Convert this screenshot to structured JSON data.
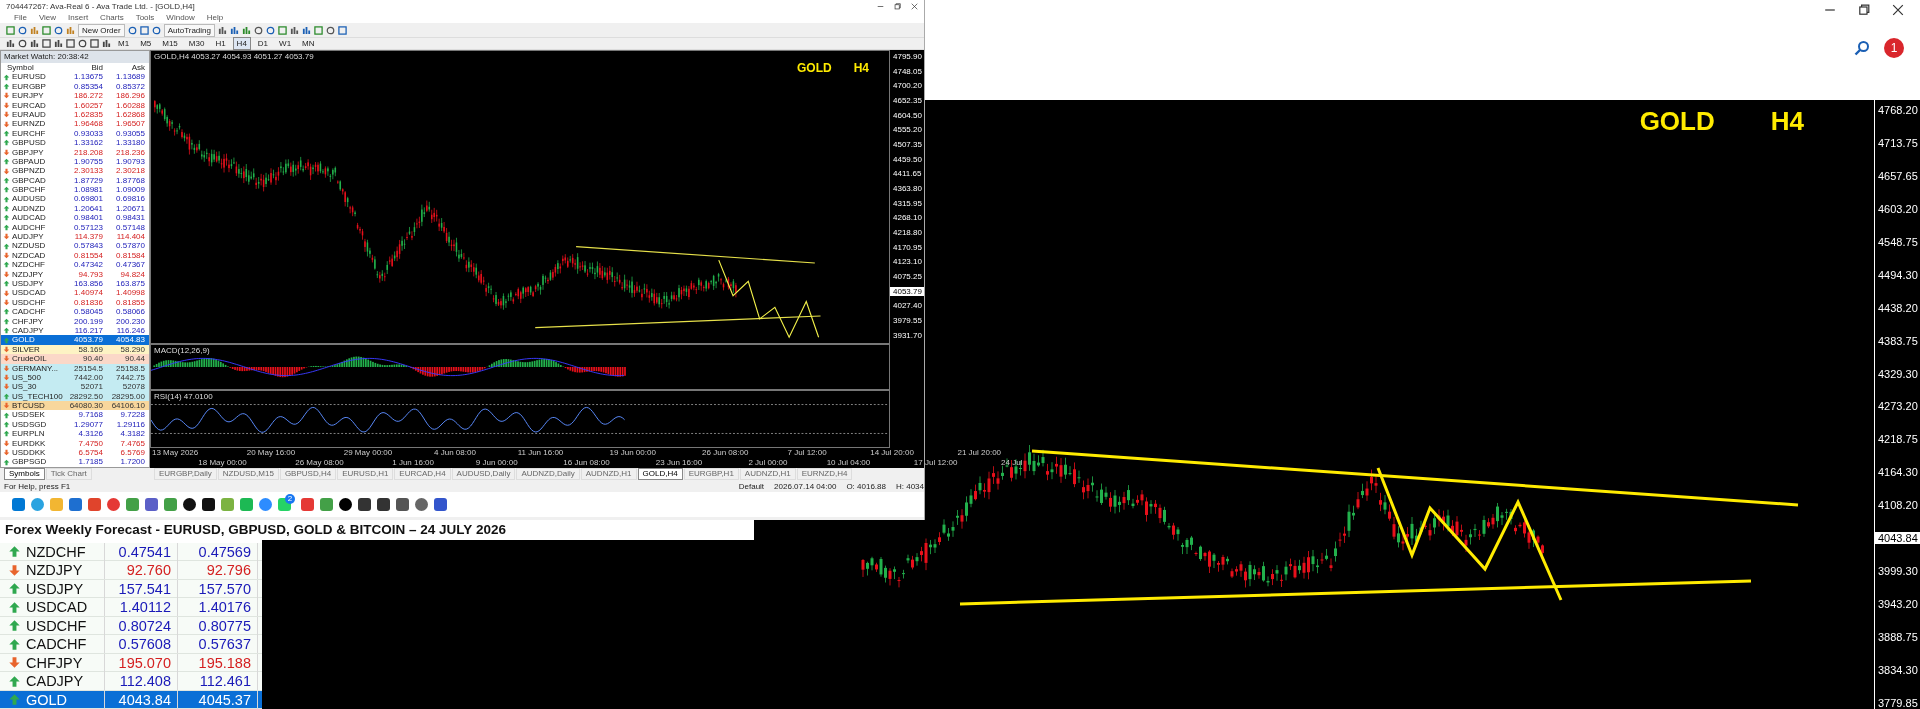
{
  "window": {
    "title": "704447267: Ava-Real 6 - Ava Trade Ltd. - [GOLD,H4]"
  },
  "menu": [
    "File",
    "View",
    "Insert",
    "Charts",
    "Tools",
    "Window",
    "Help"
  ],
  "toolbar": {
    "new_order": "New Order",
    "auto_trading": "AutoTrading"
  },
  "timeframes": [
    {
      "label": "M1",
      "selected": false
    },
    {
      "label": "M5",
      "selected": false
    },
    {
      "label": "M15",
      "selected": false
    },
    {
      "label": "M30",
      "selected": false
    },
    {
      "label": "H1",
      "selected": false
    },
    {
      "label": "H4",
      "selected": true
    },
    {
      "label": "D1",
      "selected": false
    },
    {
      "label": "W1",
      "selected": false
    },
    {
      "label": "MN",
      "selected": false
    }
  ],
  "market_watch": {
    "title": "Market Watch: 20:38:42",
    "columns": [
      "Symbol",
      "Bid",
      "Ask"
    ],
    "rows": [
      {
        "symbol": "EURUSD",
        "bid": "1.13675",
        "ask": "1.13689",
        "rising": true,
        "selected": false
      },
      {
        "symbol": "EURGBP",
        "bid": "0.85354",
        "ask": "0.85372",
        "rising": true,
        "selected": false
      },
      {
        "symbol": "EURJPY",
        "bid": "186.272",
        "ask": "186.296",
        "rising": false,
        "selected": false
      },
      {
        "symbol": "EURCAD",
        "bid": "1.60257",
        "ask": "1.60288",
        "rising": false,
        "selected": false
      },
      {
        "symbol": "EURAUD",
        "bid": "1.62835",
        "ask": "1.62868",
        "rising": false,
        "selected": false
      },
      {
        "symbol": "EURNZD",
        "bid": "1.96468",
        "ask": "1.96507",
        "rising": false,
        "selected": false
      },
      {
        "symbol": "EURCHF",
        "bid": "0.93033",
        "ask": "0.93055",
        "rising": true,
        "selected": false
      },
      {
        "symbol": "GBPUSD",
        "bid": "1.33162",
        "ask": "1.33180",
        "rising": true,
        "selected": false
      },
      {
        "symbol": "GBPJPY",
        "bid": "218.208",
        "ask": "218.236",
        "rising": false,
        "selected": false
      },
      {
        "symbol": "GBPAUD",
        "bid": "1.90755",
        "ask": "1.90793",
        "rising": true,
        "selected": false
      },
      {
        "symbol": "GBPNZD",
        "bid": "2.30133",
        "ask": "2.30218",
        "rising": false,
        "selected": false
      },
      {
        "symbol": "GBPCAD",
        "bid": "1.87729",
        "ask": "1.87768",
        "rising": true,
        "selected": false
      },
      {
        "symbol": "GBPCHF",
        "bid": "1.08981",
        "ask": "1.09009",
        "rising": true,
        "selected": false
      },
      {
        "symbol": "AUDUSD",
        "bid": "0.69801",
        "ask": "0.69816",
        "rising": true,
        "selected": false
      },
      {
        "symbol": "AUDNZD",
        "bid": "1.20641",
        "ask": "1.20671",
        "rising": true,
        "selected": false
      },
      {
        "symbol": "AUDCAD",
        "bid": "0.98401",
        "ask": "0.98431",
        "rising": true,
        "selected": false
      },
      {
        "symbol": "AUDCHF",
        "bid": "0.57123",
        "ask": "0.57148",
        "rising": true,
        "selected": false
      },
      {
        "symbol": "AUDJPY",
        "bid": "114.379",
        "ask": "114.404",
        "rising": false,
        "selected": false
      },
      {
        "symbol": "NZDUSD",
        "bid": "0.57843",
        "ask": "0.57870",
        "rising": true,
        "selected": false
      },
      {
        "symbol": "NZDCAD",
        "bid": "0.81554",
        "ask": "0.81584",
        "rising": false,
        "selected": false
      },
      {
        "symbol": "NZDCHF",
        "bid": "0.47342",
        "ask": "0.47367",
        "rising": true,
        "selected": false
      },
      {
        "symbol": "NZDJPY",
        "bid": "94.793",
        "ask": "94.824",
        "rising": false,
        "selected": false
      },
      {
        "symbol": "USDJPY",
        "bid": "163.856",
        "ask": "163.875",
        "rising": true,
        "selected": false
      },
      {
        "symbol": "USDCAD",
        "bid": "1.40974",
        "ask": "1.40998",
        "rising": false,
        "selected": false
      },
      {
        "symbol": "USDCHF",
        "bid": "0.81836",
        "ask": "0.81855",
        "rising": false,
        "selected": false
      },
      {
        "symbol": "CADCHF",
        "bid": "0.58045",
        "ask": "0.58066",
        "rising": true,
        "selected": false
      },
      {
        "symbol": "CHFJPY",
        "bid": "200.199",
        "ask": "200.230",
        "rising": true,
        "selected": false
      },
      {
        "symbol": "CADJPY",
        "bid": "116.217",
        "ask": "116.246",
        "rising": true,
        "selected": false
      },
      {
        "symbol": "GOLD",
        "bid": "4053.79",
        "ask": "4054.83",
        "rising": true,
        "selected": true
      },
      {
        "symbol": "SILVER",
        "bid": "58.169",
        "ask": "58.290",
        "rising": false,
        "selected": false,
        "color": "#fdf3c4"
      },
      {
        "symbol": "CrudeOIL",
        "bid": "90.40",
        "ask": "90.44",
        "rising": false,
        "selected": false,
        "color": "#fbd8c8"
      },
      {
        "symbol": "GERMANY...",
        "bid": "25154.5",
        "ask": "25158.5",
        "rising": false,
        "selected": false,
        "color": "#c4ebf2"
      },
      {
        "symbol": "US_500",
        "bid": "7442.00",
        "ask": "7442.75",
        "rising": false,
        "selected": false,
        "color": "#c4ebf2"
      },
      {
        "symbol": "US_30",
        "bid": "52071",
        "ask": "52078",
        "rising": false,
        "selected": false,
        "color": "#c4ebf2"
      },
      {
        "symbol": "US_TECH100",
        "bid": "28292.50",
        "ask": "28295.00",
        "rising": true,
        "selected": false,
        "color": "#c4ebf2"
      },
      {
        "symbol": "BTCUSD",
        "bid": "64080.30",
        "ask": "64106.10",
        "rising": false,
        "selected": false,
        "color": "#f8d79c"
      },
      {
        "symbol": "USDSEK",
        "bid": "9.7168",
        "ask": "9.7228",
        "rising": true,
        "selected": false
      },
      {
        "symbol": "USDSGD",
        "bid": "1.29077",
        "ask": "1.29116",
        "rising": true,
        "selected": false
      },
      {
        "symbol": "EURPLN",
        "bid": "4.3126",
        "ask": "4.3182",
        "rising": true,
        "selected": false
      },
      {
        "symbol": "EURDKK",
        "bid": "7.4750",
        "ask": "7.4765",
        "rising": false,
        "selected": false
      },
      {
        "symbol": "USDDKK",
        "bid": "6.5754",
        "ask": "6.5769",
        "rising": false,
        "selected": false
      },
      {
        "symbol": "GBPSGD",
        "bid": "1.7185",
        "ask": "1.7200",
        "rising": true,
        "selected": false
      }
    ],
    "tabs": [
      {
        "label": "Symbols",
        "selected": true
      },
      {
        "label": "Tick Chart",
        "selected": false
      }
    ]
  },
  "chart": {
    "header": "GOLD,H4 4053.27 4054.93 4051.27 4053.79",
    "symbol": "GOLD",
    "period": "H4",
    "price_labels": [
      "4795.90",
      "4748.05",
      "4700.20",
      "4652.35",
      "4604.50",
      "4555.20",
      "4507.35",
      "4459.50",
      "4411.65",
      "4363.80",
      "4315.95",
      "4268.10",
      "4218.80",
      "4170.95",
      "4123.10",
      "4075.25",
      "4027.40",
      "3979.55",
      "3931.70"
    ],
    "current_price": "4053.79",
    "macd_label": "MACD(12,26,9)",
    "rsi_label": "RSI(14) 47.0100",
    "time_labels": [
      "13 May 2026",
      "18 May 00:00",
      "20 May 16:00",
      "26 May 08:00",
      "29 May 00:00",
      "1 Jun 16:00",
      "4 Jun 08:00",
      "9 Jun 00:00",
      "11 Jun 16:00",
      "16 Jun 08:00",
      "19 Jun 00:00",
      "23 Jun 16:00",
      "26 Jun 08:00",
      "2 Jul 00:00",
      "7 Jul 12:00",
      "10 Jul 04:00",
      "14 Jul 20:00",
      "17 Jul 12:00",
      "21 Jul 20:00",
      "24 Jul"
    ]
  },
  "chart_tabs": [
    {
      "label": "EURGBP,Daily",
      "selected": false
    },
    {
      "label": "NZDUSD,M15",
      "selected": false
    },
    {
      "label": "GBPUSD,H4",
      "selected": false
    },
    {
      "label": "EURUSD,H1",
      "selected": false
    },
    {
      "label": "EURCAD,H4",
      "selected": false
    },
    {
      "label": "AUDUSD,Daily",
      "selected": false
    },
    {
      "label": "AUDNZD,Daily",
      "selected": false
    },
    {
      "label": "AUDNZD,H1",
      "selected": false
    },
    {
      "label": "GOLD,H4",
      "selected": true
    },
    {
      "label": "EURGBP,H1",
      "selected": false
    },
    {
      "label": "AUDNZD,H1",
      "selected": false
    },
    {
      "label": "EURNZD,H4",
      "selected": false
    }
  ],
  "status_bar": {
    "help": "For Help, press F1",
    "profile": "Default",
    "time": "2026.07.14 04:00",
    "open": "O: 4016.88",
    "high": "H: 4034"
  },
  "taskbar": {
    "badge": "2"
  },
  "caption": "Forex Weekly Forecast - EURUSD, GBPUSD, GOLD & BITCOIN – 24 JULY 2026",
  "main_window": {
    "notification_count": "1",
    "rows": [
      {
        "symbol": "NZDCHF",
        "bid": "0.47541",
        "ask": "0.47569",
        "rising": true,
        "selected": false
      },
      {
        "symbol": "NZDJPY",
        "bid": "92.760",
        "ask": "92.796",
        "rising": false,
        "selected": false
      },
      {
        "symbol": "USDJPY",
        "bid": "157.541",
        "ask": "157.570",
        "rising": true,
        "selected": false
      },
      {
        "symbol": "USDCAD",
        "bid": "1.40112",
        "ask": "1.40176",
        "rising": true,
        "selected": false
      },
      {
        "symbol": "USDCHF",
        "bid": "0.80724",
        "ask": "0.80775",
        "rising": true,
        "selected": false
      },
      {
        "symbol": "CADCHF",
        "bid": "0.57608",
        "ask": "0.57637",
        "rising": true,
        "selected": false
      },
      {
        "symbol": "CHFJPY",
        "bid": "195.070",
        "ask": "195.188",
        "rising": false,
        "selected": false
      },
      {
        "symbol": "CADJPY",
        "bid": "112.408",
        "ask": "112.461",
        "rising": true,
        "selected": false
      },
      {
        "symbol": "GOLD",
        "bid": "4043.84",
        "ask": "4045.37",
        "rising": true,
        "selected": true
      }
    ],
    "chart": {
      "symbol": "GOLD",
      "period": "H4",
      "price_labels": [
        "4768.20",
        "4713.75",
        "4657.65",
        "4603.20",
        "4548.75",
        "4494.30",
        "4438.20",
        "4383.75",
        "4329.30",
        "4273.20",
        "4218.75",
        "4164.30",
        "4108.20",
        "3999.30",
        "3943.20",
        "3888.75",
        "3834.30",
        "3779.85"
      ],
      "current_price": "4043.84"
    }
  }
}
